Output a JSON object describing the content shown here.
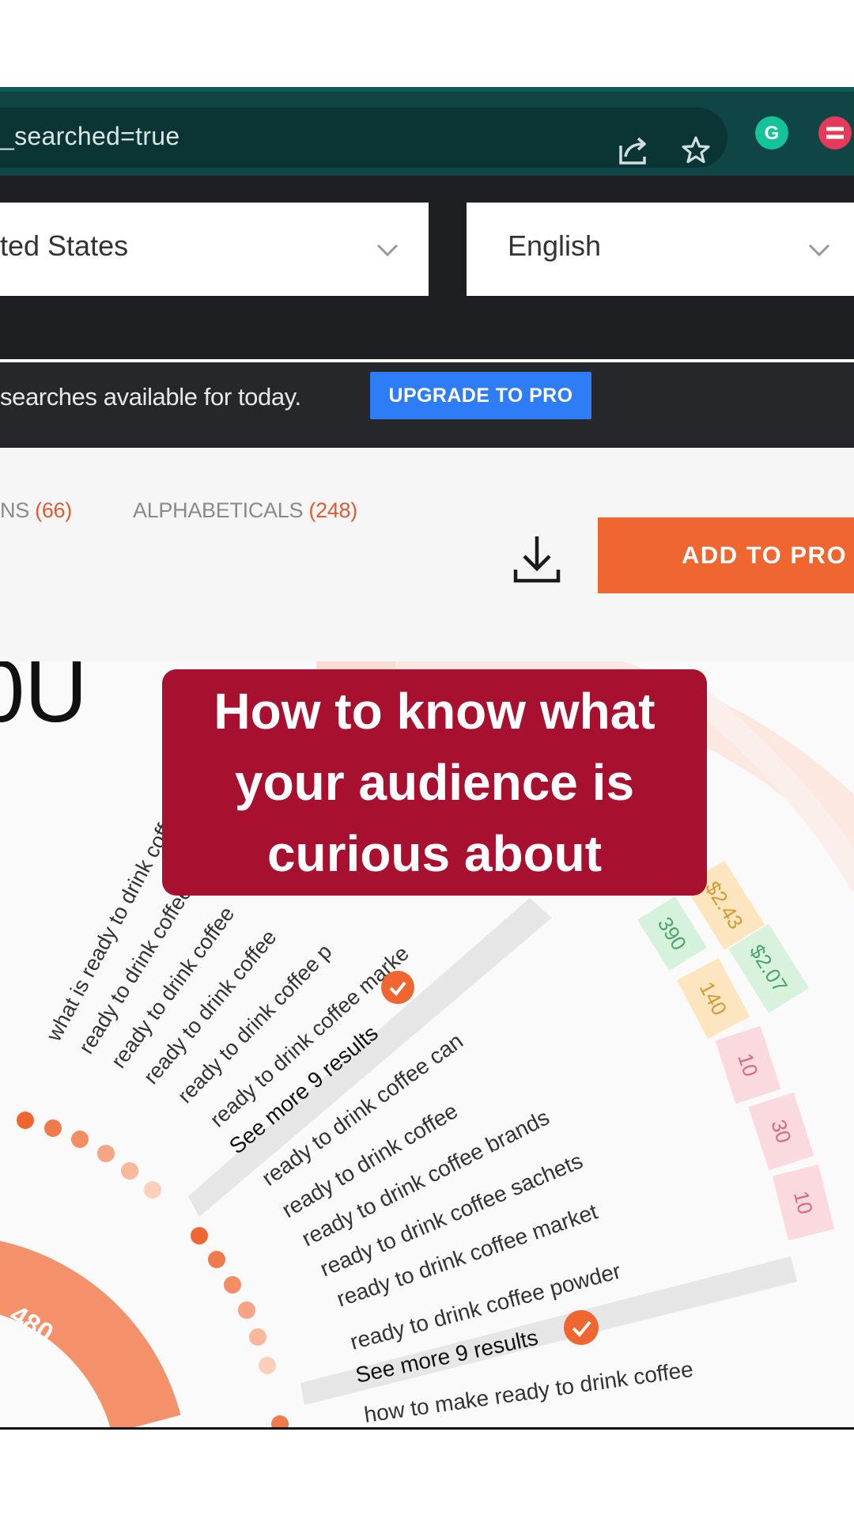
{
  "browser": {
    "url_fragment": "_searched=true",
    "icons": [
      "share-icon",
      "star-icon",
      "grammarly-icon",
      "extension-icon"
    ],
    "grammarly_letter": "G"
  },
  "filters": {
    "country": "ted States",
    "language": "English"
  },
  "upgrade_bar": {
    "text": "searches available for today.",
    "button": "UPGRADE TO PRO"
  },
  "tabs": [
    {
      "label": "NS",
      "count": "(66)"
    },
    {
      "label": "ALPHABETICALS",
      "count": "(248)"
    }
  ],
  "actions": {
    "add_label": "ADD TO PRO"
  },
  "viz": {
    "big_number": "0U",
    "donut_value": "480",
    "group_a": [
      "what is ready to drink coffee",
      "ready to drink coffee",
      "ready to drink coffee",
      "ready to drink coffee",
      "ready to drink coffee p",
      "ready to drink coffee marke"
    ],
    "see_more_a": "See more 9 results",
    "group_b": [
      "ready to drink coffee can",
      "ready to drink coffee",
      "ready to drink coffee brands",
      "ready to drink coffee sachets",
      "ready to drink coffee market",
      "ready to drink coffee powder"
    ],
    "see_more_b": "See more 9 results",
    "group_c": [
      "how to make ready to drink coffee"
    ],
    "metrics": {
      "volume_green": "390",
      "cpc_top": "$2.43",
      "cpc_green": "$2.07",
      "volume_orange": "140",
      "pink": [
        "10",
        "30",
        "10"
      ]
    }
  },
  "caption": {
    "line1": "How to know what",
    "line2": "your audience is",
    "line3": "curious about"
  },
  "colors": {
    "browser_bar": "#0f4545",
    "accent_orange": "#ef6631",
    "upgrade_blue": "#2f7df6",
    "caption_red": "#a8102f"
  }
}
